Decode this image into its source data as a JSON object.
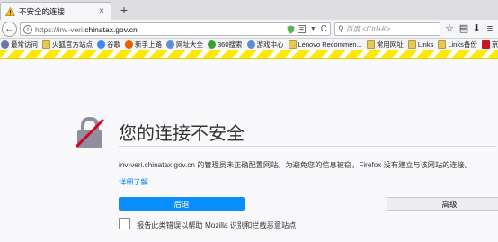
{
  "tab": {
    "title": "不安全的连接",
    "close": "×",
    "new_tab": "+"
  },
  "nav": {
    "back": "←",
    "url_prefix": "https://inv-veri.",
    "url_domain": "chinatax.gov.cn",
    "reload": "C",
    "search_placeholder": "百度 <Ctrl+K>"
  },
  "bookmarks": [
    {
      "label": "最常访问",
      "icon": "gear"
    },
    {
      "label": "火狐官方站点",
      "icon": "folder"
    },
    {
      "label": "谷歌",
      "icon": "g"
    },
    {
      "label": "新手上路",
      "icon": "ff"
    },
    {
      "label": "网址大全",
      "icon": "globe"
    },
    {
      "label": "360搜索",
      "icon": "s360"
    },
    {
      "label": "游戏中心",
      "icon": "globe"
    },
    {
      "label": "Lenovo Recommen...",
      "icon": "folder"
    },
    {
      "label": "常用网址",
      "icon": "folder"
    },
    {
      "label": "Links",
      "icon": "folder"
    },
    {
      "label": "Links备份",
      "icon": "folder"
    },
    {
      "label": "京东商城",
      "icon": "jd"
    }
  ],
  "error": {
    "title": "您的连接不安全",
    "description": "inv-veri.chinatax.gov.cn 的管理员未正确配置网站。为避免您的信息被窃，Firefox 没有建立与该网站的连接。",
    "learn_more": "详细了解…",
    "back_button": "后退",
    "advanced_button": "高级",
    "report_label": "报告此类错误以帮助 Mozilla 识别和拦截恶意站点"
  },
  "colors": {
    "primary_button": "#0a8dff",
    "link": "#0a84ff",
    "stripe": "#ffe900"
  }
}
